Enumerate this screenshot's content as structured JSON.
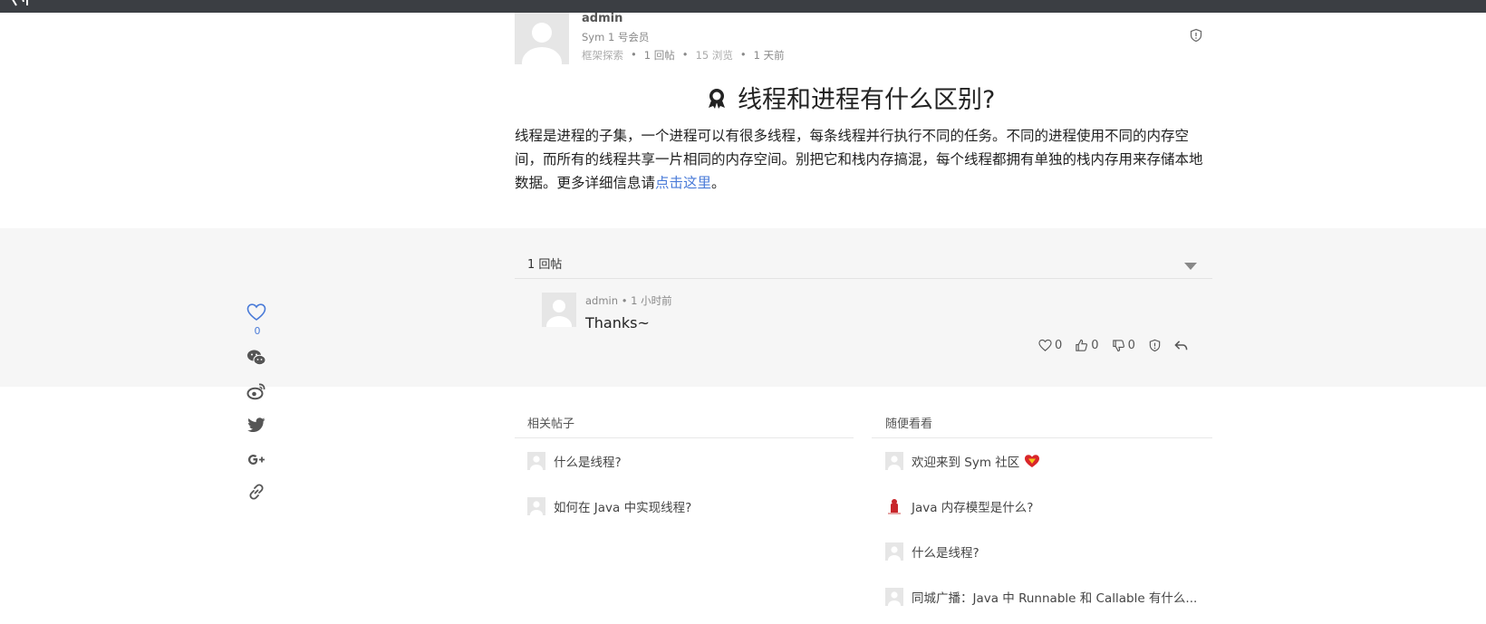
{
  "post": {
    "author": "admin",
    "level": "Sym 1 号会员",
    "category": "框架探索",
    "replies": "1 回帖",
    "views": "15 浏览",
    "time": "1 天前",
    "title": "线程和进程有什么区别?",
    "body_text": "线程是进程的子集，一个进程可以有很多线程，每条线程并行执行不同的任务。不同的进程使用不同的内存空间，而所有的线程共享一片相同的内存空间。别把它和栈内存搞混，每个线程都拥有单独的栈内存用来存储本地数据。更多详细信息请",
    "body_link": "点击这里",
    "body_end": "。"
  },
  "side_actions": {
    "like_count": "0",
    "icons": [
      "heart-icon",
      "wechat-icon",
      "weibo-icon",
      "twitter-icon",
      "google-plus-icon",
      "link-icon"
    ]
  },
  "reply_section": {
    "header": "1 回帖",
    "reply": {
      "author": "admin",
      "sep": "•",
      "time": "1 小时前",
      "text": "Thanks~",
      "thanks_count": "0",
      "up_count": "0",
      "down_count": "0"
    }
  },
  "related": {
    "title": "相关帖子",
    "items": [
      "什么是线程?",
      "如何在 Java 中实现线程?"
    ]
  },
  "random": {
    "title": "随便看看",
    "items": [
      "欢迎来到 Sym 社区",
      "Java 内存模型是什么?",
      "什么是线程?",
      "同城广播：Java 中 Runnable 和 Callable 有什么..."
    ]
  },
  "colors": {
    "accent": "#4a7bd8",
    "topbar": "#3b3e43",
    "band": "#f6f6f6"
  }
}
